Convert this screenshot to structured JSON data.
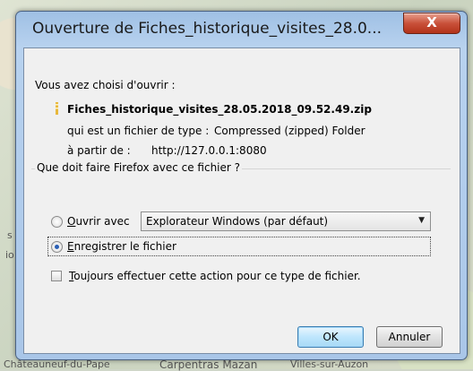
{
  "window": {
    "title": "Ouverture de Fiches_historique_visites_28.0...",
    "close_label": "X"
  },
  "dialog": {
    "intro": "Vous avez choisi d'ouvrir :",
    "filename": "Fiches_historique_visites_28.05.2018_09.52.49.zip",
    "type_label": "qui est un fichier de type :",
    "type_value": "Compressed (zipped) Folder",
    "from_label": "à partir de :",
    "from_value": "http://127.0.0.1:8080",
    "question": "Que doit faire Firefox avec ce fichier ?",
    "open_with_first": "O",
    "open_with_rest": "uvrir avec",
    "open_with_app": "Explorateur Windows (par défaut)",
    "save_first": "E",
    "save_rest": "nregistrer le fichier",
    "always_first": "T",
    "always_rest": "oujours effectuer cette action pour ce type de fichier.",
    "ok_label": "OK",
    "cancel_label": "Annuler"
  },
  "map_labels": {
    "bottom_left": "Châteauneuf-du-Pape",
    "bottom_center": "Carpentras  Mazan",
    "bottom_right": "Villes-sur-Auzon",
    "left_1": "s",
    "left_2": "io"
  },
  "colors": {
    "title_bar": "#b8d2ef",
    "close_button": "#c9513a",
    "dialog_bg": "#f0f0f0"
  }
}
